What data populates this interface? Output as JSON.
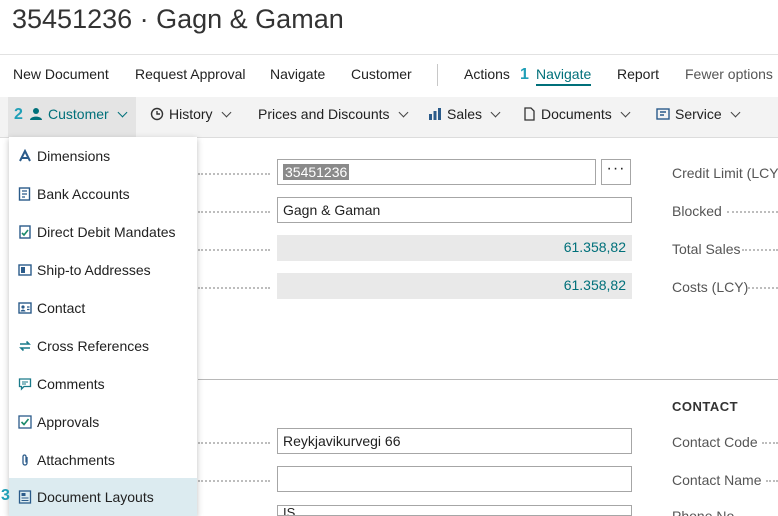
{
  "page": {
    "title": "35451236 · Gagn & Gaman"
  },
  "actions": {
    "new_document": "New Document",
    "request_approval": "Request Approval",
    "navigate": "Navigate",
    "customer": "Customer",
    "actions": "Actions",
    "navigate_tab": "Navigate",
    "report": "Report",
    "fewer_options": "Fewer options"
  },
  "steps": {
    "one": "1",
    "two": "2",
    "three": "3"
  },
  "subnav": {
    "customer": "Customer",
    "history": "History",
    "prices": "Prices and Discounts",
    "sales": "Sales",
    "documents": "Documents",
    "service": "Service"
  },
  "menu": {
    "items": [
      {
        "label": "Dimensions",
        "icon": "dimensions-icon"
      },
      {
        "label": "Bank Accounts",
        "icon": "bank-icon"
      },
      {
        "label": "Direct Debit Mandates",
        "icon": "mandate-icon"
      },
      {
        "label": "Ship-to Addresses",
        "icon": "address-icon"
      },
      {
        "label": "Contact",
        "icon": "contact-card-icon"
      },
      {
        "label": "Cross References",
        "icon": "swap-icon"
      },
      {
        "label": "Comments",
        "icon": "comment-icon"
      },
      {
        "label": "Approvals",
        "icon": "approval-icon"
      },
      {
        "label": "Attachments",
        "icon": "paperclip-icon"
      },
      {
        "label": "Document Layouts",
        "icon": "document-layout-icon"
      }
    ]
  },
  "form": {
    "no_value": "35451236",
    "name_value": "Gagn & Gaman",
    "balance_value": "61.358,82",
    "balance_due_value": "61.358,82",
    "address_value": "Reykjavikurvegi 66",
    "address2_value": "",
    "country_partial": "IS"
  },
  "right": {
    "credit_limit": "Credit Limit (LCY)",
    "blocked": "Blocked",
    "total_sales": "Total Sales",
    "costs": "Costs (LCY)",
    "contact_section": "CONTACT",
    "contact_code": "Contact Code",
    "contact_name": "Contact Name",
    "phone_partial": "Phone No."
  },
  "colors": {
    "accent": "#00707a",
    "step": "#1f9fb7",
    "highlight": "#dcebf0"
  }
}
